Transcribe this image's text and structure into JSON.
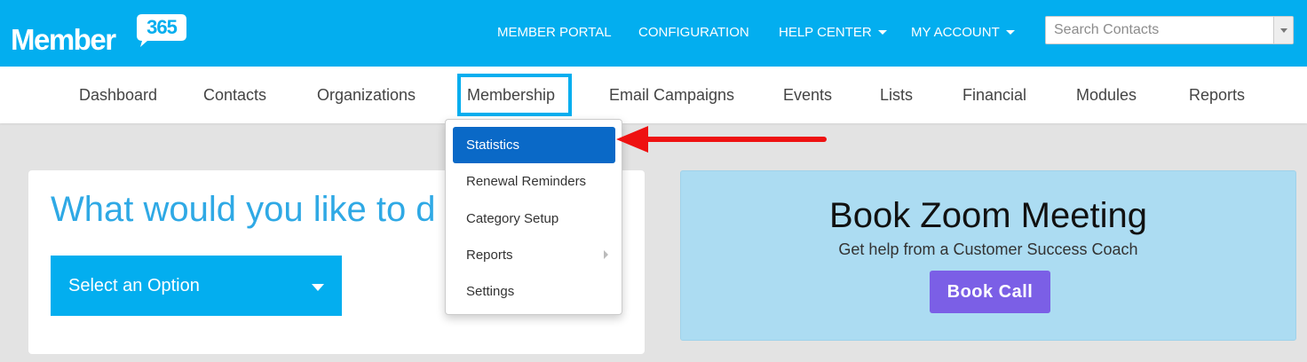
{
  "brand": {
    "name": "Member",
    "badge": "365"
  },
  "top_nav": [
    {
      "label": "MEMBER PORTAL",
      "has_caret": false
    },
    {
      "label": "CONFIGURATION",
      "has_caret": false
    },
    {
      "label": "HELP CENTER",
      "has_caret": true
    },
    {
      "label": "MY ACCOUNT",
      "has_caret": true
    }
  ],
  "search": {
    "placeholder": "Search Contacts"
  },
  "main_nav": [
    {
      "label": "Dashboard"
    },
    {
      "label": "Contacts"
    },
    {
      "label": "Organizations"
    },
    {
      "label": "Membership",
      "highlighted": true
    },
    {
      "label": "Email Campaigns"
    },
    {
      "label": "Events"
    },
    {
      "label": "Lists"
    },
    {
      "label": "Financial"
    },
    {
      "label": "Modules"
    },
    {
      "label": "Reports"
    }
  ],
  "membership_menu": [
    {
      "label": "Statistics",
      "active": true
    },
    {
      "label": "Renewal Reminders"
    },
    {
      "label": "Category Setup"
    },
    {
      "label": "Reports",
      "has_submenu": true
    },
    {
      "label": "Settings"
    }
  ],
  "left_card": {
    "title": "What would you like to d",
    "select_label": "Select an Option"
  },
  "zoom_card": {
    "title": "Book Zoom Meeting",
    "subtitle": "Get help from a Customer Success Coach",
    "button": "Book Call"
  },
  "colors": {
    "brand_blue": "#03aeef",
    "menu_active": "#0a69c7",
    "book_button": "#7b5fe6",
    "zoom_card_bg": "#acdcf2",
    "annotation_red": "#ee1111"
  },
  "icons": {
    "select_arrow": "caret-down-icon",
    "submenu_arrow": "caret-right-icon",
    "annotation": "red-arrow-icon"
  }
}
